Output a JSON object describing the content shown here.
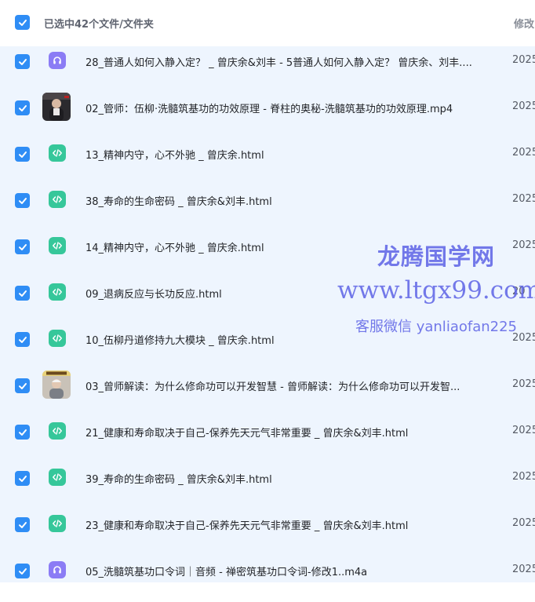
{
  "header": {
    "selection_text": "已选中42个文件/文件夹",
    "modified_column": "修改"
  },
  "files": [
    {
      "name": "28_普通人如何入静入定？ _ 曾庆余&刘丰 - 5普通人如何入静入定？ 曾庆余、刘丰....",
      "date": "2025",
      "icon": "audio-icon"
    },
    {
      "name": "02_管师：伍柳·洗髓筑基功的功效原理 - 脊柱的奥秘-洗髓筑基功的功效原理.mp4",
      "date": "2025",
      "icon": "video-thumbnail"
    },
    {
      "name": "13_精神内守，心不外驰 _ 曾庆余.html",
      "date": "2025",
      "icon": "html-file-icon"
    },
    {
      "name": "38_寿命的生命密码 _ 曾庆余&刘丰.html",
      "date": "2025",
      "icon": "html-file-icon"
    },
    {
      "name": "14_精神内守，心不外驰 _ 曾庆余.html",
      "date": "2025",
      "icon": "html-file-icon"
    },
    {
      "name": "09_退病反应与长功反应.html",
      "date": "20",
      "icon": "html-file-icon"
    },
    {
      "name": "10_伍柳丹道修持九大模块 _ 曾庆余.html",
      "date": "2025",
      "icon": "html-file-icon"
    },
    {
      "name": "03_曾师解读：为什么修命功可以开发智慧 - 曾师解读：为什么修命功可以开发智...",
      "date": "2025",
      "icon": "video-thumbnail"
    },
    {
      "name": "21_健康和寿命取决于自己-保养先天元气非常重要 _ 曾庆余&刘丰.html",
      "date": "2025",
      "icon": "html-file-icon"
    },
    {
      "name": "39_寿命的生命密码 _ 曾庆余&刘丰.html",
      "date": "2025",
      "icon": "html-file-icon"
    },
    {
      "name": "23_健康和寿命取决于自己-保养先天元气非常重要 _ 曾庆余&刘丰.html",
      "date": "2025",
      "icon": "html-file-icon"
    },
    {
      "name": "05_洗髓筑基功口令词｜音频 - 禅密筑基功口令词-修改1..m4a",
      "date": "2025",
      "icon": "audio-icon"
    }
  ],
  "watermark": {
    "line1": "龙腾国学网",
    "line2": "www.ltgx99.com",
    "line3": "客服微信 yanliaofan225"
  },
  "colors": {
    "checkbox": "#2f8df5",
    "html_icon": "#36c79a",
    "audio_icon": "#8b7cf5",
    "selected_row_bg": "#eef5fe",
    "watermark": "#5d63e6"
  }
}
